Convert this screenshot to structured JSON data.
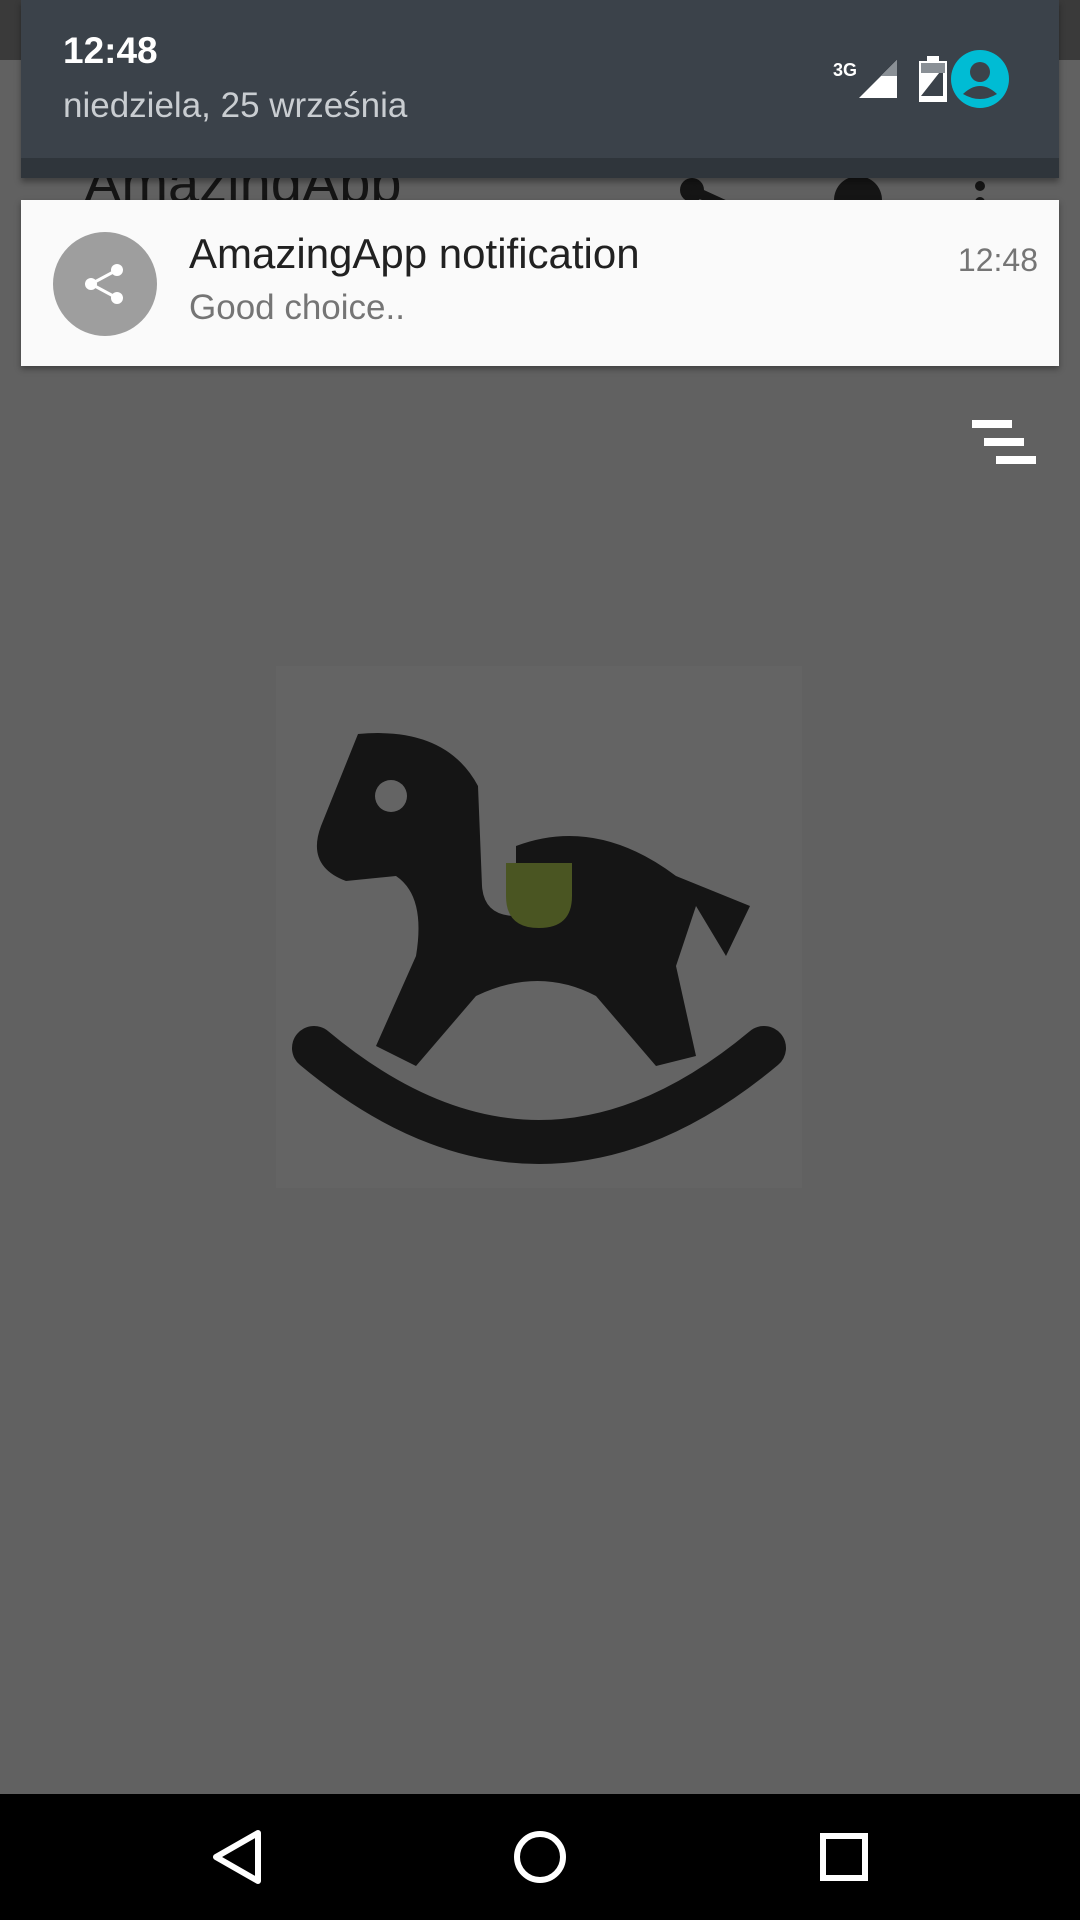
{
  "status_shade": {
    "time": "12:48",
    "date": "niedziela, 25 września",
    "network_label": "3G",
    "icons": [
      "signal-3g-icon",
      "battery-icon",
      "user-account-icon"
    ],
    "accent_color": "#00bcd4"
  },
  "app": {
    "title": "AmazingApp",
    "actions": [
      "share-icon",
      "settings-gear-icon",
      "overflow-menu-icon"
    ],
    "content_icons": [
      "menu-lines-icon",
      "rocking-horse-icon"
    ],
    "saddle_color": "#4a5522"
  },
  "notification": {
    "icon": "share-icon",
    "title": "AmazingApp notification",
    "text": "Good choice..",
    "time": "12:48"
  },
  "navbar": {
    "buttons": [
      "back-icon",
      "home-icon",
      "recents-icon"
    ]
  }
}
